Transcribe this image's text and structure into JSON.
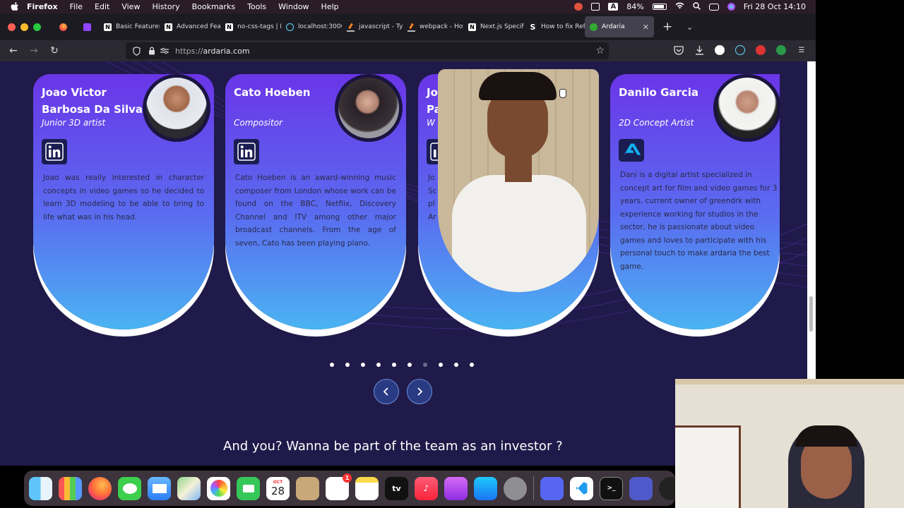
{
  "menubar": {
    "app": "Firefox",
    "items": [
      "File",
      "Edit",
      "View",
      "History",
      "Bookmarks",
      "Tools",
      "Window",
      "Help"
    ],
    "battery": "84%",
    "datetime": "Fri 28 Oct  14:10",
    "a_indicator": "A"
  },
  "tabs": [
    {
      "label": "Basic Features",
      "icon": "notion-icon"
    },
    {
      "label": "Advanced Feat",
      "icon": "notion-icon"
    },
    {
      "label": "no-css-tags | N",
      "icon": "notion-icon"
    },
    {
      "label": "localhost:3000/",
      "icon": "react-icon"
    },
    {
      "label": "javascript - Typ",
      "icon": "stackoverflow-icon"
    },
    {
      "label": "webpack - How",
      "icon": "stackoverflow-icon"
    },
    {
      "label": "Next.js Specific",
      "icon": "notion-icon"
    },
    {
      "label": "How to fix Refe",
      "icon": "s-icon"
    },
    {
      "label": "Ardaria",
      "icon": "ardaria-icon"
    }
  ],
  "url": {
    "scheme": "https://",
    "host": "ardaria.com"
  },
  "team": [
    {
      "name": "Joao Victor Barbosa Da Silva",
      "role": "Junior 3D artist",
      "social": "linkedin-icon",
      "bio": "Joao was really interested in character concepts in video games so he decided to learn 3D modeling to be able to bring to life what was in his head."
    },
    {
      "name": "Cato Hoeben",
      "role": "Compositor",
      "social": "linkedin-icon",
      "bio": "Cato Hoeben is an award-winning music composer from London whose work can be found on the BBC, Netflix, Discovery Channel and ITV among other major broadcast channels. From the age of seven, Cato has been playing piano."
    },
    {
      "name": "Jo Pa",
      "role": "W",
      "social": "linkedin-icon",
      "bio": "Jo Sc pl Ar"
    },
    {
      "name": "Danilo Garcia",
      "role": "2D Concept Artist",
      "social": "artstation-icon",
      "bio": "Dani is a digital artist specialized in concept art for film and video games for 3 years, current owner of greendrk with experience working for studios in the sector, he is passionate about video games and loves to participate with his personal touch to make ardaria the best game."
    }
  ],
  "carousel": {
    "dot_count": 10,
    "active_dot": 7
  },
  "headline": "And you? Wanna be part of the team as an investor ?",
  "dock": {
    "calendar_month": "OCT",
    "calendar_day": "28",
    "reminders_badge": "1",
    "tv_label": "tv",
    "apps": [
      "finder-icon",
      "launchpad-icon",
      "firefox-icon",
      "messages-icon",
      "mail-icon",
      "maps-icon",
      "photos-icon",
      "facetime-icon",
      "calendar-icon",
      "contacts-icon",
      "reminders-icon",
      "notes-icon",
      "appletv-icon",
      "music-icon",
      "podcasts-icon",
      "appstore-icon",
      "settings-icon",
      "discord-icon",
      "vscode-icon",
      "terminal-icon",
      "teams-icon",
      "obs-icon"
    ]
  },
  "colors": {
    "page_bg": "#201a4a",
    "card_top": "#6a35e8",
    "card_bottom": "#4ab4f2"
  }
}
